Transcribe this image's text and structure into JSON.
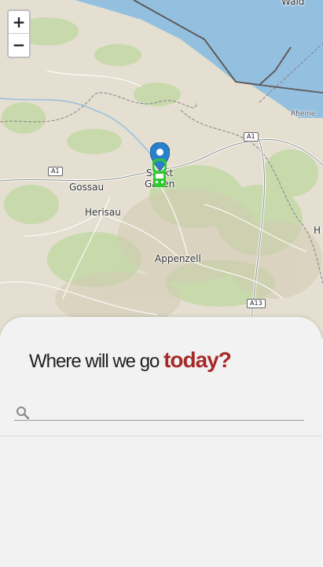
{
  "map": {
    "zoom_in_label": "+",
    "zoom_out_label": "−",
    "places": {
      "wald": "Wald",
      "rheineck": "Rheine",
      "gossau": "Gossau",
      "herisau": "Herisau",
      "st_gallen_1": "Sankt",
      "st_gallen_2": "Gallen",
      "appenzell": "Appenzell",
      "heiden": "H"
    },
    "road_shields": {
      "a1_east": "A1",
      "a1_west": "A1",
      "a13": "A13"
    },
    "colors": {
      "lake": "#94c0e0",
      "land": "#e4dfd0",
      "forest": "#c4d8a6",
      "marker_blue": "#2a81cb",
      "bus_green": "#2fcc2f"
    }
  },
  "panel": {
    "title_lead": "Where will we go ",
    "title_accent": "today?",
    "accent_color": "#a62a2a",
    "search_placeholder": ""
  }
}
